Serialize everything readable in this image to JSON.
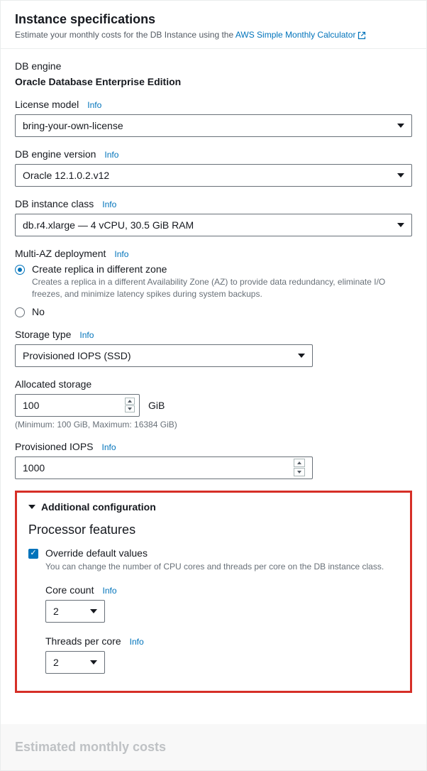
{
  "header": {
    "title": "Instance specifications",
    "subtitle_prefix": "Estimate your monthly costs for the DB Instance using the ",
    "calc_link": "AWS Simple Monthly Calculator"
  },
  "db_engine": {
    "label": "DB engine",
    "value": "Oracle Database Enterprise Edition"
  },
  "license_model": {
    "label": "License model",
    "info": "Info",
    "value": "bring-your-own-license"
  },
  "engine_version": {
    "label": "DB engine version",
    "info": "Info",
    "value": "Oracle 12.1.0.2.v12"
  },
  "instance_class": {
    "label": "DB instance class",
    "info": "Info",
    "value": "db.r4.xlarge — 4 vCPU, 30.5 GiB RAM"
  },
  "multi_az": {
    "label": "Multi-AZ deployment",
    "info": "Info",
    "opt1_title": "Create replica in different zone",
    "opt1_desc": "Creates a replica in a different Availability Zone (AZ) to provide data redundancy, eliminate I/O freezes, and minimize latency spikes during system backups.",
    "opt2_title": "No"
  },
  "storage_type": {
    "label": "Storage type",
    "info": "Info",
    "value": "Provisioned IOPS (SSD)"
  },
  "allocated_storage": {
    "label": "Allocated storage",
    "value": "100",
    "unit": "GiB",
    "hint": "(Minimum: 100 GiB, Maximum: 16384 GiB)"
  },
  "provisioned_iops": {
    "label": "Provisioned IOPS",
    "info": "Info",
    "value": "1000"
  },
  "additional": {
    "header": "Additional configuration",
    "section_title": "Processor features",
    "override_label": "Override default values",
    "override_desc": "You can change the number of CPU cores and threads per core on the DB instance class.",
    "core_count": {
      "label": "Core count",
      "info": "Info",
      "value": "2"
    },
    "threads": {
      "label": "Threads per core",
      "info": "Info",
      "value": "2"
    }
  },
  "footer": {
    "title": "Estimated monthly costs"
  }
}
